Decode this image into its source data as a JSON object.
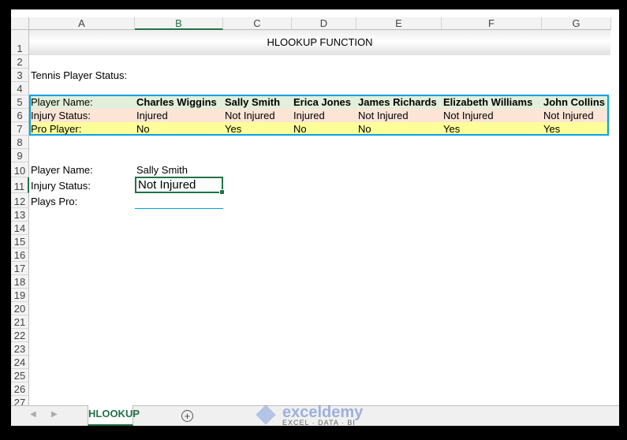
{
  "columns": [
    "A",
    "B",
    "C",
    "D",
    "E",
    "F",
    "G"
  ],
  "rows": [
    "1",
    "2",
    "3",
    "4",
    "5",
    "6",
    "7",
    "8",
    "9",
    "10",
    "11",
    "12",
    "13",
    "14",
    "15",
    "16",
    "17",
    "18",
    "19",
    "20",
    "21",
    "22",
    "23",
    "24",
    "25",
    "26",
    "27"
  ],
  "title": "HLOOKUP FUNCTION",
  "section_label": "Tennis Player Status:",
  "table": {
    "row_labels": [
      "Player Name:",
      "Injury Status:",
      "Pro Player:"
    ],
    "players": [
      {
        "name": "Charles Wiggins",
        "injury": "Injured",
        "pro": "No"
      },
      {
        "name": "Sally Smith",
        "injury": "Not Injured",
        "pro": "Yes"
      },
      {
        "name": "Erica Jones",
        "injury": "Injured",
        "pro": "No"
      },
      {
        "name": "James Richards",
        "injury": "Not Injured",
        "pro": "No"
      },
      {
        "name": "Elizabeth Williams",
        "injury": "Not Injured",
        "pro": "Yes"
      },
      {
        "name": "John Collins",
        "injury": "Not Injured",
        "pro": "Yes"
      }
    ]
  },
  "lookup": {
    "labels": [
      "Player Name:",
      "Injury Status:",
      "Plays Pro:"
    ],
    "player_name": "Sally Smith",
    "injury_status": "Not Injured",
    "plays_pro": ""
  },
  "sheet_tab": "HLOOKUP",
  "watermark": {
    "name": "exceldemy",
    "tagline": "EXCEL · DATA · BI"
  },
  "colors": {
    "accent": "#217346",
    "table_border": "#00a2e8",
    "row_name": "#e2efda",
    "row_injury": "#fce4d6",
    "row_pro": "#ffff99"
  }
}
